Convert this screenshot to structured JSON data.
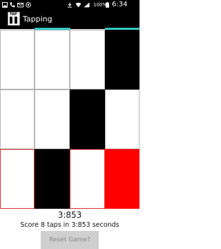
{
  "status_bar": {
    "battery": "100%",
    "time": "6:34 AM",
    "icons": [
      "image-icon",
      "phone-icon",
      "mail-icon",
      "notification-icon",
      "download-icon",
      "wifi-icon",
      "signal-icon",
      "battery-icon"
    ]
  },
  "action_bar": {
    "logo_text": "TAP",
    "title": "Tapping"
  },
  "grid": {
    "rows": 3,
    "cols": 4,
    "cells": [
      [
        "white",
        "white",
        "white",
        "black"
      ],
      [
        "white",
        "white",
        "black",
        "white"
      ],
      [
        "white",
        "black",
        "white",
        "red"
      ]
    ]
  },
  "game": {
    "timer": "3:853",
    "score_text": "Score 8 taps in 3:853 seconds",
    "reset_label": "Reset Game?"
  },
  "colors": {
    "accent": "#33c9c4",
    "tile_black": "#000000",
    "tile_red": "#ff0000"
  }
}
